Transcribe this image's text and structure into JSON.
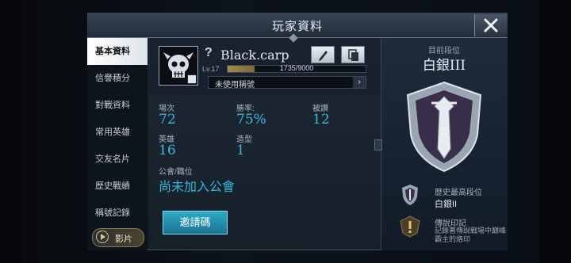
{
  "window": {
    "title": "玩家資料"
  },
  "tabs": [
    {
      "label": "基本資料",
      "active": true
    },
    {
      "label": "信譽積分"
    },
    {
      "label": "對戰資料"
    },
    {
      "label": "常用英雄"
    },
    {
      "label": "交友名片"
    },
    {
      "label": "歷史戰績"
    },
    {
      "label": "稱號記錄"
    }
  ],
  "video_button": {
    "label": "影片"
  },
  "player": {
    "question_mark": "?",
    "name": "Black.carp",
    "level": "Lv.17",
    "exp_text": "1735/9000",
    "exp_fraction": 0.193,
    "title_placeholder": "未使用稱號"
  },
  "stats": {
    "matches_label": "場次",
    "matches": "72",
    "winrate_label": "勝率:",
    "winrate": "75%",
    "likes_label": "被讚",
    "likes": "12",
    "heroes_label": "英雄",
    "heroes": "16",
    "skins_label": "造型",
    "skins": "1",
    "guild_label": "公會/職位",
    "guild": "尚未加入公會"
  },
  "invite_button": {
    "label": "邀請碼"
  },
  "rank": {
    "current_label": "目前段位",
    "current": "白銀III",
    "highest_label": "歷史最高段位",
    "highest": "白銀II",
    "legend_label": "傳說印記",
    "legend_desc": "記錄著傳說戰場中巔峰霸主的烙印"
  },
  "colors": {
    "accent": "#33b8d8",
    "exp_fill": "#a28b4f"
  }
}
